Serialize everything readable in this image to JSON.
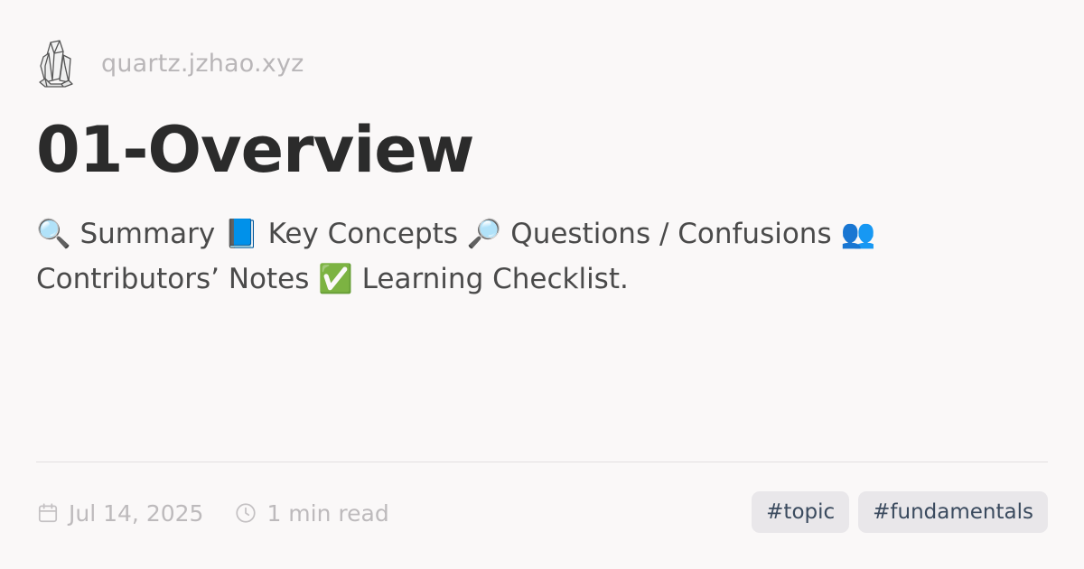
{
  "header": {
    "logo_icon": "crystal-icon",
    "site_url": "quartz.jzhao.xyz"
  },
  "page": {
    "title": "01-Overview",
    "description": "🔍 Summary 📘 Key Concepts 🔎 Questions / Confusions 👥 Contributors’ Notes ✅ Learning Checklist."
  },
  "meta": {
    "date_icon": "calendar-icon",
    "date": "Jul 14, 2025",
    "reading_icon": "clock-icon",
    "reading_time": "1 min read"
  },
  "tags": [
    {
      "label": "#topic"
    },
    {
      "label": "#fundamentals"
    }
  ],
  "colors": {
    "background": "#faf8f8",
    "title": "#2b2b2b",
    "muted": "#bdbabc",
    "tag_bg": "#e9e7ea",
    "tag_text": "#3a4a5e"
  }
}
